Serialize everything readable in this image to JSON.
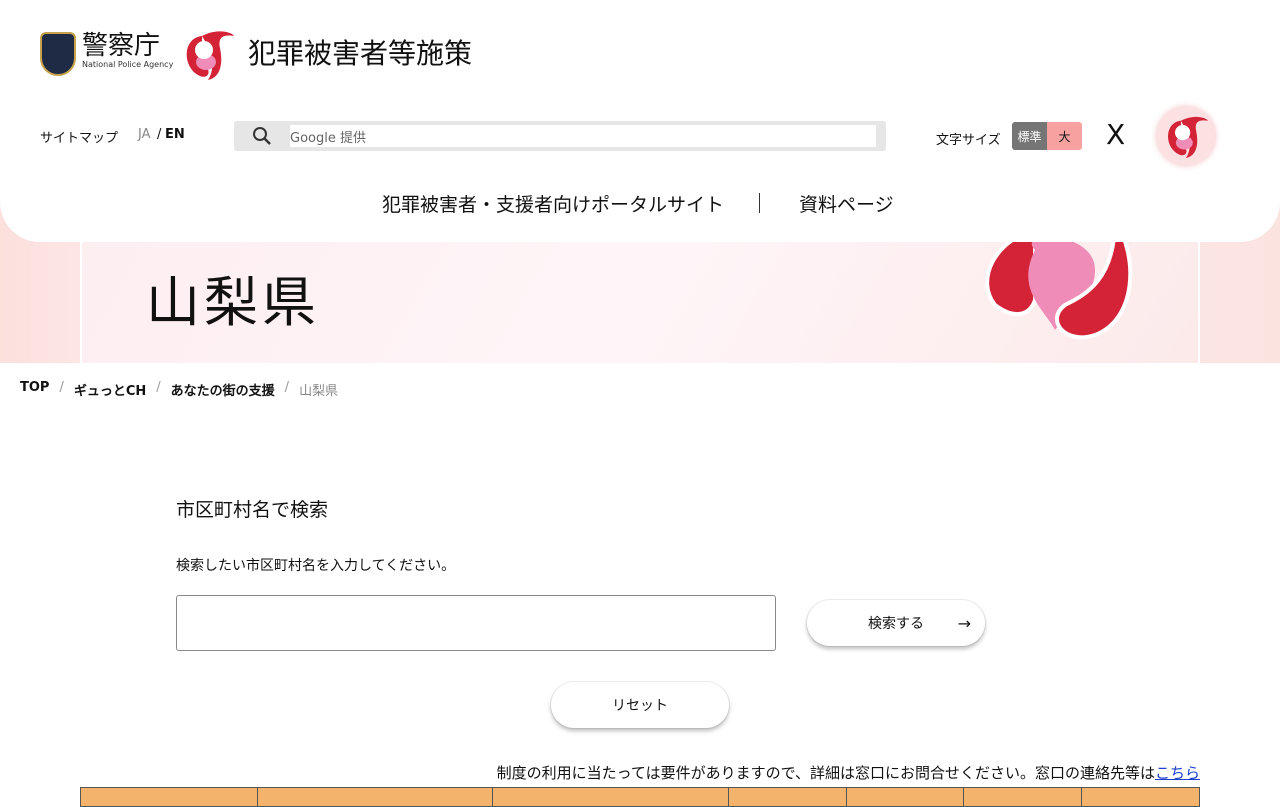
{
  "header": {
    "agency": "警察庁",
    "agency_en": "National Police Agency",
    "site_title": "犯罪被害者等施策",
    "sitemap": "サイトマップ",
    "lang_ja": "JA",
    "lang_sep": "/",
    "lang_en": "EN",
    "search_placeholder": "Google 提供",
    "font_size_label": "文字サイズ",
    "font_standard": "標準",
    "font_large": "大",
    "x_icon": "X"
  },
  "nav": {
    "items": [
      "犯罪被害者・支援者向けポータルサイト",
      "資料ページ"
    ]
  },
  "hero": {
    "title": "山梨県"
  },
  "breadcrumb": [
    "TOP",
    "ギュっとCH",
    "あなたの街の支援",
    "山梨県"
  ],
  "search": {
    "heading": "市区町村名で検索",
    "description": "検索したい市区町村名を入力してください。",
    "value": "",
    "submit": "検索する",
    "reset": "リセット"
  },
  "notice": {
    "text": "制度の利用に当たっては要件がありますので、詳細は窓口にお問合せください。窓口の連絡先等は",
    "link": "こちら"
  },
  "colors": {
    "accent": "#d42336",
    "table_header": "#f4b36d",
    "font_active": "#757575",
    "font_large": "#f7a1a1"
  }
}
